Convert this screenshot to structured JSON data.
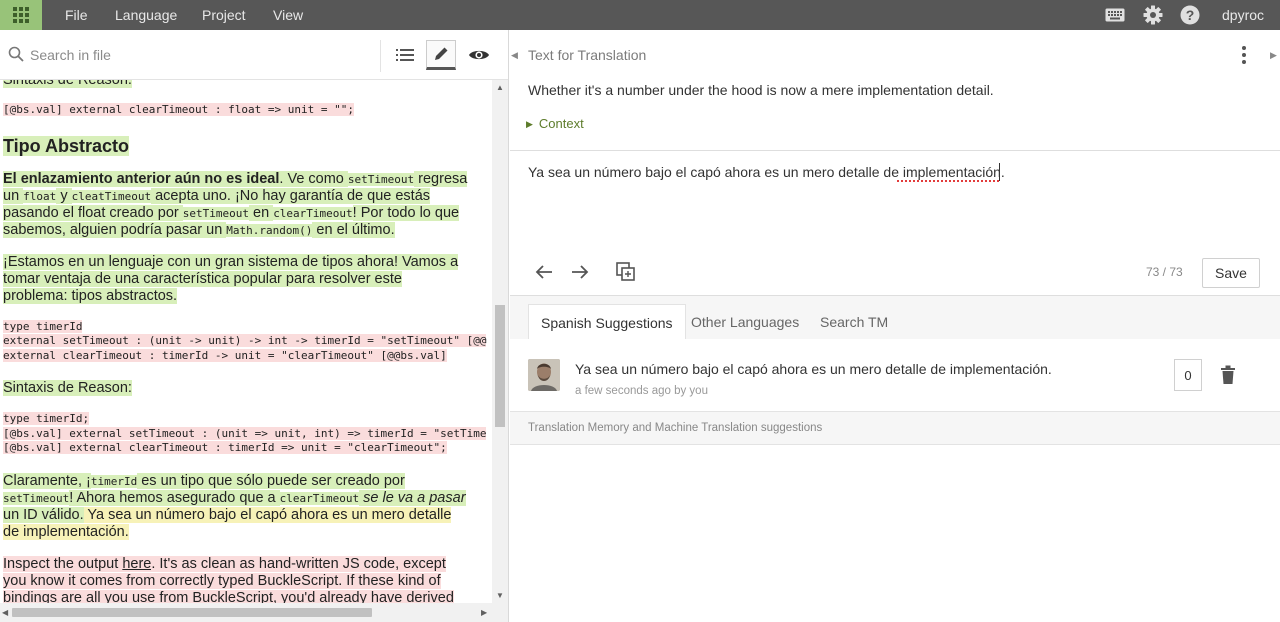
{
  "topbar": {
    "menu": [
      "File",
      "Language",
      "Project",
      "View"
    ],
    "username": "dpyroc"
  },
  "left": {
    "search_placeholder": "Search in file",
    "doc": {
      "reason_syntax_top": "Sintaxis de Reason:",
      "code1": "[@bs.val] external clearTimeout : float => unit = \"\";",
      "heading": "Tipo Abstracto",
      "p1": {
        "bold": "El enlazamiento anterior aún no es ideal",
        "a": ". Ve como ",
        "c1": "setTimeout",
        "b": " regresa",
        "c": "un ",
        "c2": "float",
        "d": " y ",
        "c3": "cleatTimeout",
        "e": " acepta uno.",
        "f": " ¡No hay garantía de que estás",
        "g": "pasando el float creado por ",
        "c4": "setTimeout",
        "h": " en ",
        "c5": "clearTimeout",
        "i": "! Por todo lo que",
        "j": "sabemos, alguien podría pasar un ",
        "c6": "Math.random()",
        "k": " en el último."
      },
      "p2": {
        "l1a": "¡Estamos en un lenguaje con un gran sistema de tipos ahora",
        "l1b": "! Vamos a",
        "l2": "tomar ventaja de una característica popular para resolver este",
        "l3": "problema: tipos abstractos."
      },
      "code2": [
        "type timerId",
        "external setTimeout : (unit -> unit) -> int -> timerId = \"setTimeout\" [@@",
        "external clearTimeout : timerId -> unit = \"clearTimeout\" [@@bs.val]"
      ],
      "reason_syntax": "Sintaxis de Reason:",
      "code3": [
        "type timerId;",
        "[@bs.val] external setTimeout : (unit => unit, int) => timerId = \"setTime",
        "[@bs.val] external clearTimeout : timerId => unit = \"clearTimeout\";"
      ],
      "p3": {
        "a": "Claramente, ¡",
        "c1": "timerId",
        "b": " es un tipo que sólo puede ser creado por",
        "c2": "setTimeout",
        "c": "! Ahora hemos asegurado que a ",
        "c3": "clearTimeout",
        "d": " se le va a pasar",
        "e": "un ID válido.",
        "f": " Ya sea un número bajo el capó ahora es un mero detalle",
        "g": "de implementación."
      },
      "p4": {
        "a": "Inspect the output ",
        "link": "here",
        "b": ". It's as clean as hand-written JS code, except",
        "l2": "you know it comes from correctly typed BuckleScript. If these kind of",
        "l3": "bindings are all you use from BuckleScript, you'd already have derived"
      }
    }
  },
  "right": {
    "source_title": "Text for Translation",
    "source_text": "Whether it's a number under the hood is now a mere implementation detail.",
    "context_label": "Context",
    "translation_value": "Ya sea un número bajo el capó ahora es un mero detalle de implementación.",
    "counter": "73 / 73",
    "save_label": "Save",
    "tabs": [
      "Spanish Suggestions",
      "Other Languages",
      "Search TM"
    ],
    "suggestion": {
      "text": "Ya sea un número bajo el capó ahora es un mero detalle de implementación.",
      "meta": "a few seconds ago by you",
      "votes": "0"
    },
    "tm_label": "Translation Memory and Machine Translation suggestions"
  }
}
